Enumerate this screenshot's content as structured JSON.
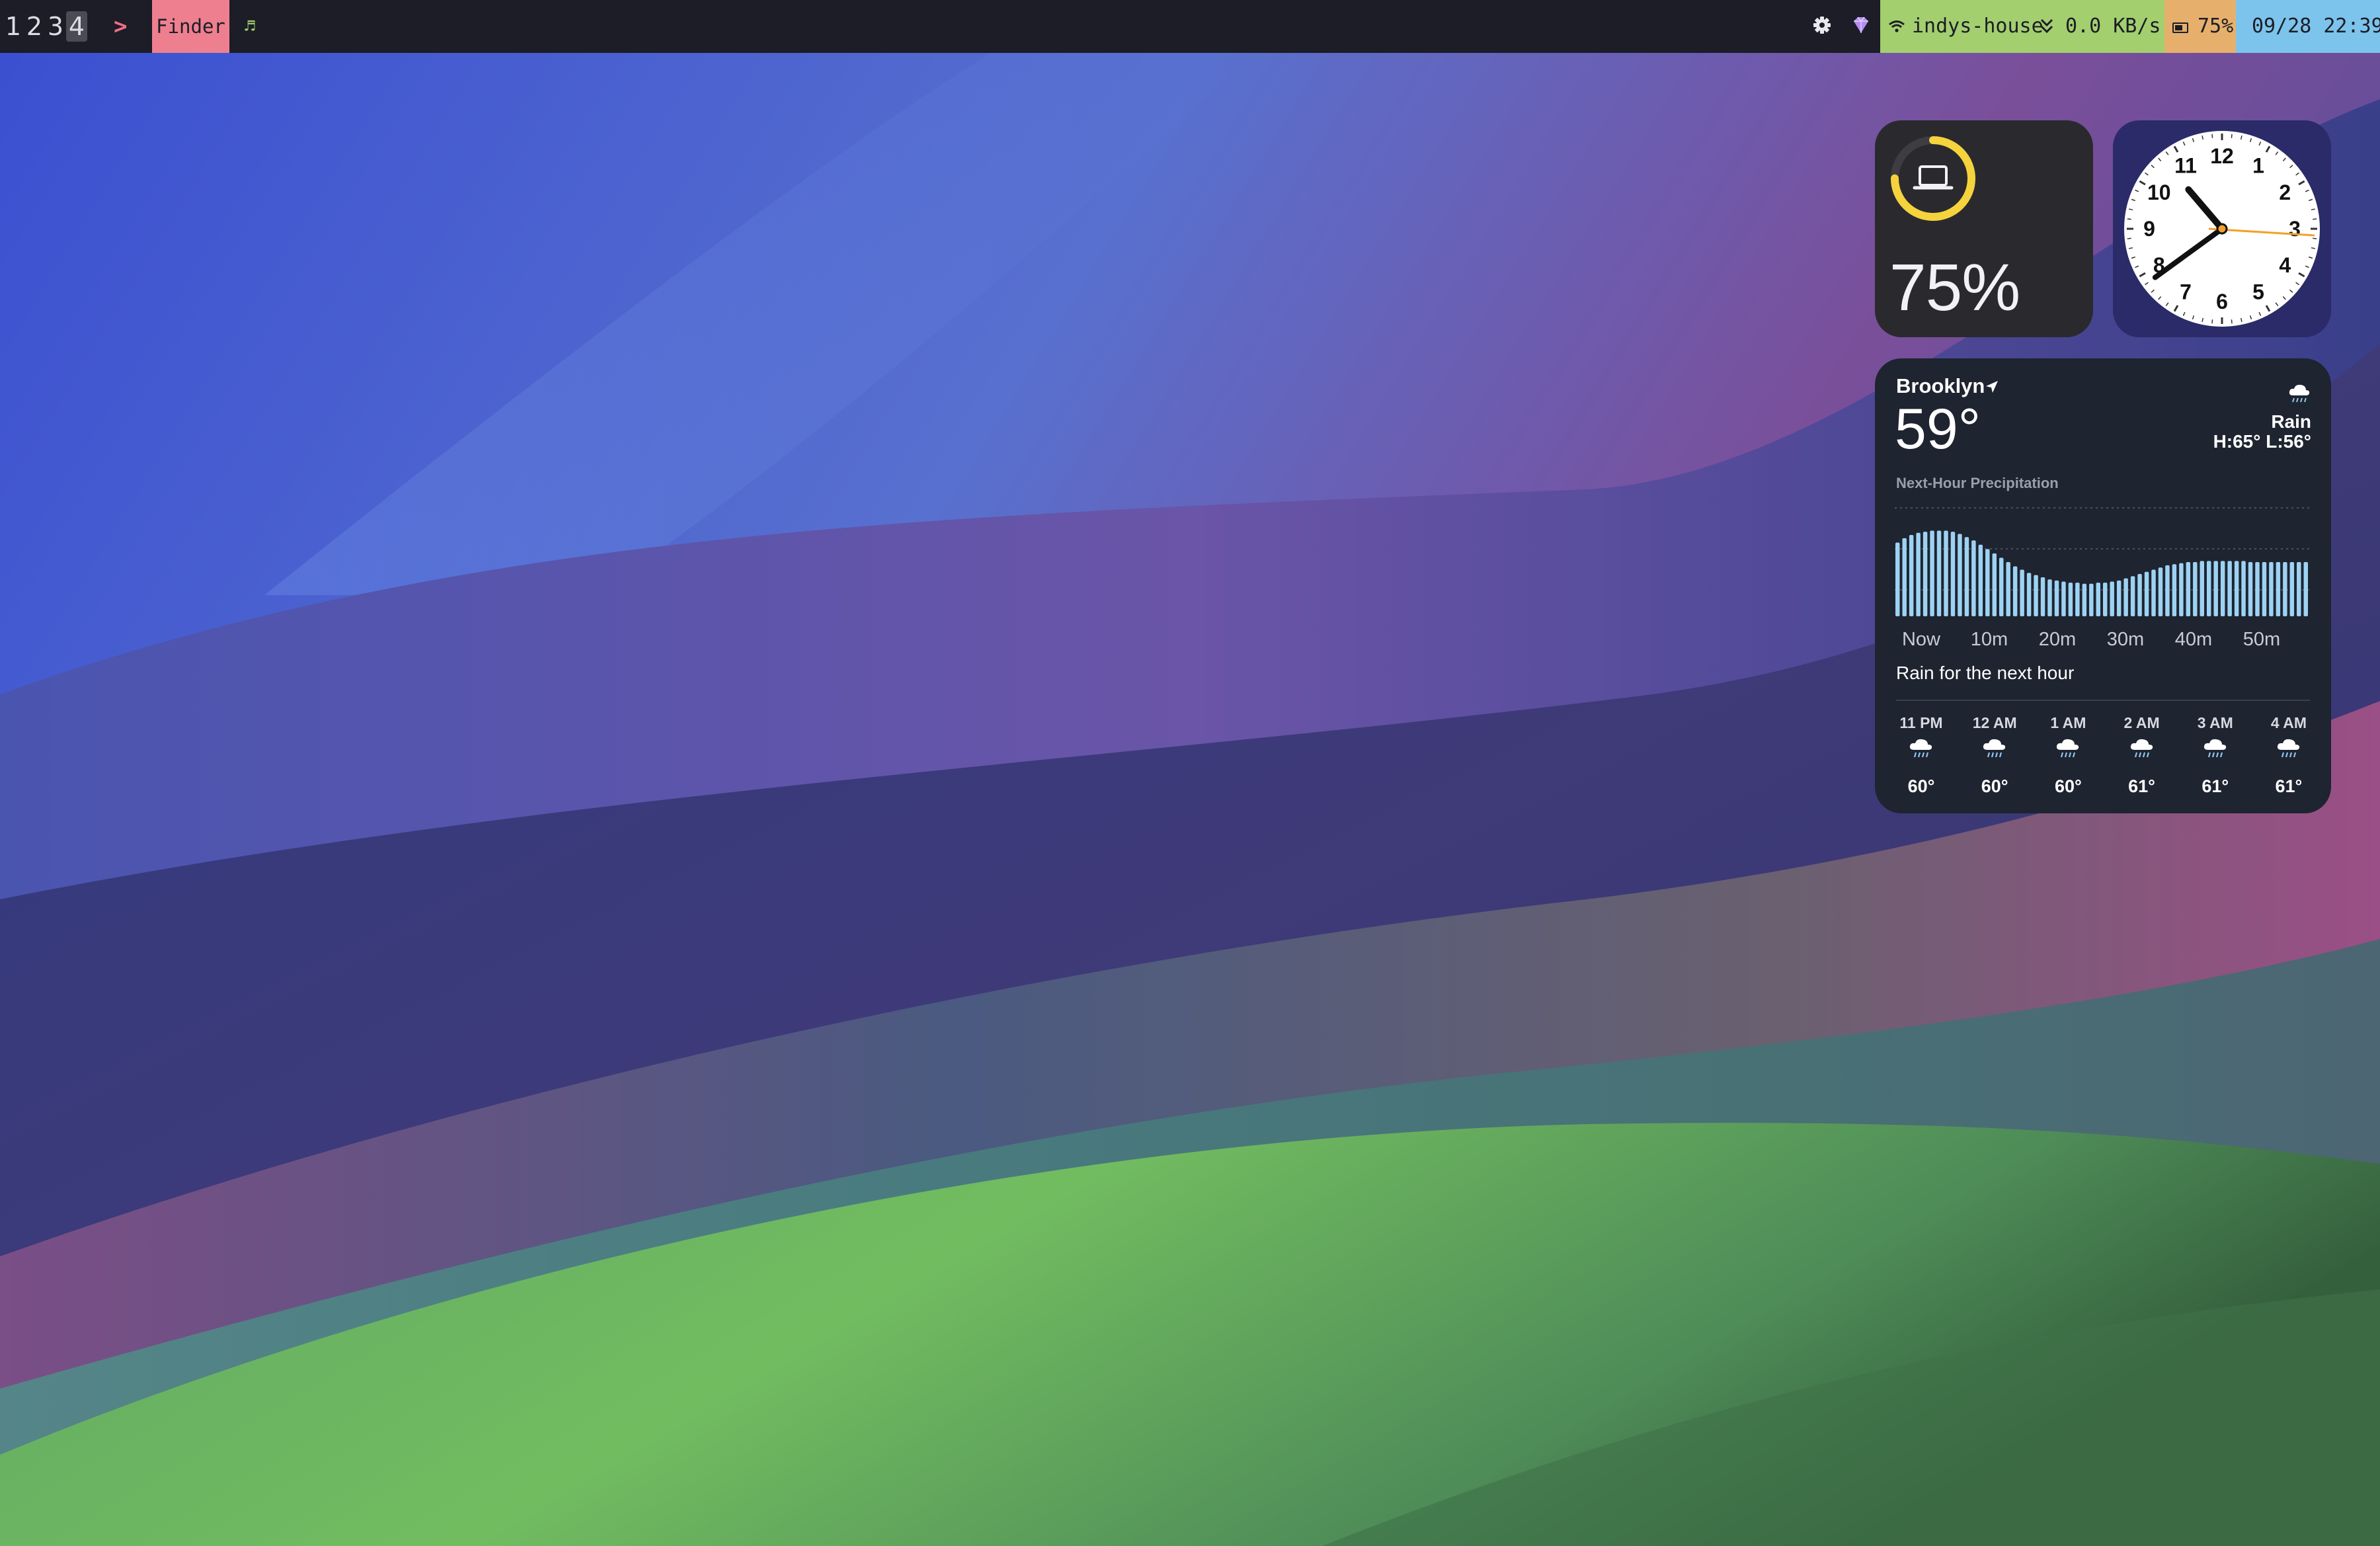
{
  "menubar": {
    "workspaces": [
      "1",
      "2",
      "3",
      "4"
    ],
    "active_workspace": "4",
    "chevron": ">",
    "app_name": "Finder",
    "music_icon": "music-note-icon",
    "status_icons": [
      "gear-icon",
      "diamond-icon",
      "wifi-icon"
    ],
    "network_name": "indys-house",
    "network_speed": "0.0 KB/s",
    "battery": "75%",
    "datetime": "09/28 22:39",
    "colors": {
      "bar": "#1c1d26",
      "app_bg": "#ee7f8f",
      "network_bg": "#a3cf6f",
      "battery_bg": "#e6b06c",
      "date_bg": "#7cc4ec"
    }
  },
  "battery_widget": {
    "percent_label": "75%",
    "level": 0.75,
    "ring_color": "#f5d33c",
    "device_icon": "laptop-icon"
  },
  "clock_widget": {
    "numerals": [
      "12",
      "1",
      "2",
      "3",
      "4",
      "5",
      "6",
      "7",
      "8",
      "9",
      "10",
      "11"
    ],
    "time": "22:39"
  },
  "weather_widget": {
    "city": "Brooklyn",
    "temperature": "59°",
    "condition": "Rain",
    "high_low": "H:65° L:56°",
    "precip_title": "Next-Hour Precipitation",
    "precip_axis": [
      "Now",
      "10m",
      "20m",
      "30m",
      "40m",
      "50m"
    ],
    "precip_intensity": [
      0.68,
      0.72,
      0.75,
      0.77,
      0.78,
      0.79,
      0.79,
      0.79,
      0.78,
      0.76,
      0.73,
      0.7,
      0.66,
      0.62,
      0.58,
      0.54,
      0.5,
      0.46,
      0.43,
      0.4,
      0.38,
      0.36,
      0.34,
      0.33,
      0.32,
      0.31,
      0.31,
      0.3,
      0.3,
      0.31,
      0.31,
      0.32,
      0.33,
      0.35,
      0.37,
      0.39,
      0.41,
      0.43,
      0.45,
      0.47,
      0.48,
      0.49,
      0.5,
      0.5,
      0.51,
      0.51,
      0.51,
      0.51,
      0.51,
      0.51,
      0.51,
      0.5,
      0.5,
      0.5,
      0.5,
      0.5,
      0.5,
      0.5,
      0.5,
      0.5
    ],
    "summary": "Rain for the next hour",
    "hourly": [
      {
        "time": "11 PM",
        "temp": "60°"
      },
      {
        "time": "12 AM",
        "temp": "60°"
      },
      {
        "time": "1 AM",
        "temp": "60°"
      },
      {
        "time": "2 AM",
        "temp": "61°"
      },
      {
        "time": "3 AM",
        "temp": "61°"
      },
      {
        "time": "4 AM",
        "temp": "61°"
      }
    ]
  }
}
